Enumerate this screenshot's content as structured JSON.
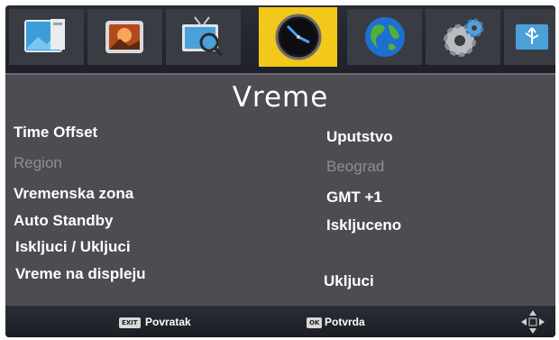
{
  "menu": {
    "tabs": [
      {
        "name": "picture",
        "icon": "picture-icon",
        "active": false
      },
      {
        "name": "image",
        "icon": "photo-icon",
        "active": false
      },
      {
        "name": "search",
        "icon": "tv-search-icon",
        "active": false
      },
      {
        "name": "time",
        "icon": "clock-icon",
        "active": true
      },
      {
        "name": "language",
        "icon": "globe-icon",
        "active": false
      },
      {
        "name": "settings",
        "icon": "gear-icon",
        "active": false
      },
      {
        "name": "usb",
        "icon": "usb-icon",
        "active": false
      }
    ],
    "accent_color": "#f2c81a"
  },
  "page": {
    "title": "Vreme"
  },
  "settings": [
    {
      "label": "Time Offset",
      "value": "Uputstvo",
      "enabled": true
    },
    {
      "label": "Region",
      "value": "Beograd",
      "enabled": false
    },
    {
      "label": "Vremenska zona",
      "value": "GMT +1",
      "enabled": true
    },
    {
      "label": "Auto Standby",
      "value": "Iskljuceno",
      "enabled": true
    },
    {
      "label": "Iskljuci / Ukljuci",
      "value": "",
      "enabled": true
    },
    {
      "label": "Vreme na displeju",
      "value": "Ukljuci",
      "enabled": true
    }
  ],
  "footer": {
    "exit_key": "EXIT",
    "exit_label": "Povratak",
    "ok_key": "OK",
    "ok_label": "Potvrda",
    "nav_icon": "navigation-arrows-icon"
  }
}
